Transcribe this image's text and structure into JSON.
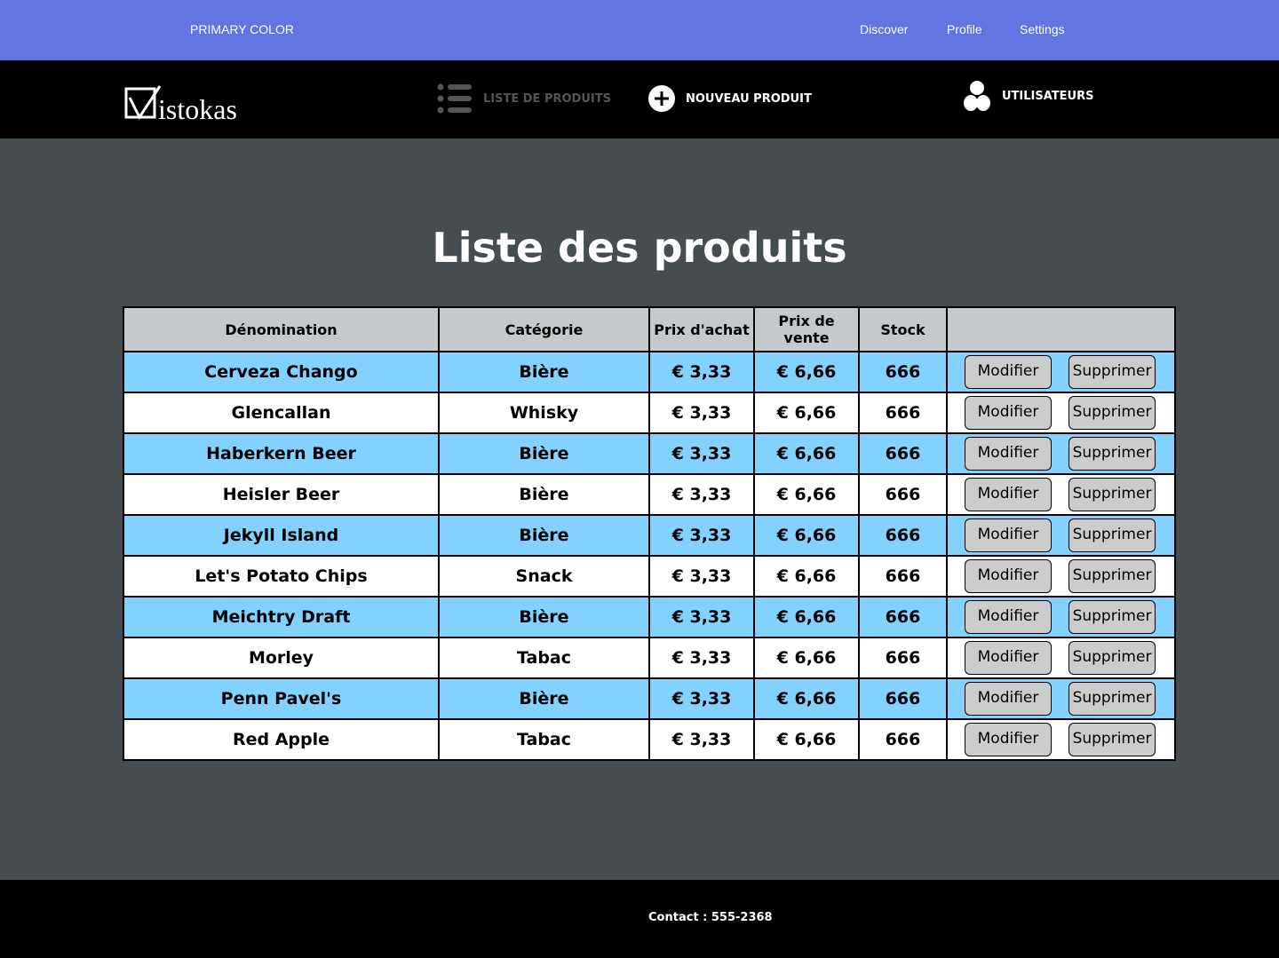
{
  "topbar": {
    "brand": "PRIMARY COLOR",
    "links": [
      "Discover",
      "Profile",
      "Settings"
    ]
  },
  "nav": {
    "logo_text": "istokas",
    "products_label": "LISTE DE PRODUITS",
    "new_product_label": "NOUVEAU PRODUIT",
    "users_label": "UTILISATEURS"
  },
  "main": {
    "title": "Liste des produits",
    "table": {
      "columns": [
        "Dénomination",
        "Catégorie",
        "Prix d'achat",
        "Prix de vente",
        "Stock",
        ""
      ],
      "rows": [
        {
          "name": "Cerveza Chango",
          "category": "Bière",
          "buy": "€ 3,33",
          "sell": "€ 6,66",
          "stock": "666"
        },
        {
          "name": "Glencallan",
          "category": "Whisky",
          "buy": "€ 3,33",
          "sell": "€ 6,66",
          "stock": "666"
        },
        {
          "name": "Haberkern Beer",
          "category": "Bière",
          "buy": "€ 3,33",
          "sell": "€ 6,66",
          "stock": "666"
        },
        {
          "name": "Heisler Beer",
          "category": "Bière",
          "buy": "€ 3,33",
          "sell": "€ 6,66",
          "stock": "666"
        },
        {
          "name": "Jekyll Island",
          "category": "Bière",
          "buy": "€ 3,33",
          "sell": "€ 6,66",
          "stock": "666"
        },
        {
          "name": "Let's Potato Chips",
          "category": "Snack",
          "buy": "€ 3,33",
          "sell": "€ 6,66",
          "stock": "666"
        },
        {
          "name": "Meichtry Draft",
          "category": "Bière",
          "buy": "€ 3,33",
          "sell": "€ 6,66",
          "stock": "666"
        },
        {
          "name": "Morley",
          "category": "Tabac",
          "buy": "€ 3,33",
          "sell": "€ 6,66",
          "stock": "666"
        },
        {
          "name": "Penn Pavel's",
          "category": "Bière",
          "buy": "€ 3,33",
          "sell": "€ 6,66",
          "stock": "666"
        },
        {
          "name": "Red Apple",
          "category": "Tabac",
          "buy": "€ 3,33",
          "sell": "€ 6,66",
          "stock": "666"
        }
      ],
      "edit_label": "Modifier",
      "delete_label": "Supprimer"
    }
  },
  "footer": {
    "contact": "Contact : 555-2368"
  },
  "colors": {
    "topbar": "#6175e1",
    "navbar": "#000000",
    "background": "#464d51",
    "row_highlight": "#82d1fe",
    "row_plain": "#ffffff",
    "header_cell": "#c6c9cb",
    "button": "#cccccc",
    "nav_inactive": "#555555"
  },
  "icons": {
    "logo": "checkbox-check-icon",
    "products": "list-icon",
    "new_product": "plus-circle-icon",
    "users": "user-icon"
  }
}
